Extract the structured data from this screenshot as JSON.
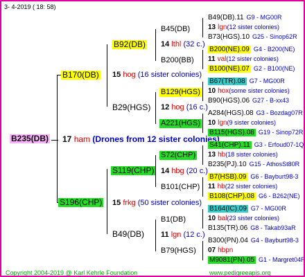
{
  "header": {
    "date": "3-  4-2019  ( 18:  58)"
  },
  "footer": {
    "copyright": "Copyright 2004-2019 @ Karl Kehrle Foundation",
    "url": "www.pedigreeapis.org"
  },
  "root": {
    "id": "B235(DB)",
    "num": "17",
    "label": "ham",
    "note": "(Drones from 12 sister colonies)"
  },
  "gen1": [
    {
      "id": "B170(DB)",
      "num": "15",
      "label": "hog",
      "note": "(16 sister colonies)"
    },
    {
      "id": "S196(CHP)",
      "num": "15",
      "label": "frkg",
      "note": "(50 sister colonies)"
    }
  ],
  "gen2": [
    {
      "id": "B92(DB)",
      "num": "14",
      "label": "lthl",
      "note": "(32 c.)"
    },
    {
      "id": "B29(HGS)",
      "num": "12",
      "label": "hog",
      "note": "(16 c.)"
    },
    {
      "id": "S119(CHP)",
      "num": "14",
      "label": "hbg",
      "note": "(20 c.)"
    },
    {
      "id": "B49(DB)",
      "num": "11",
      "label": "lgn",
      "note": "(12 c.)"
    }
  ],
  "gen3": [
    {
      "id": "B45(DB)"
    },
    {
      "id": "B200(BB)"
    },
    {
      "id": "B129(HGS)"
    },
    {
      "id": "A221(HGS)"
    },
    {
      "id": "S72(CHP)"
    },
    {
      "id": "B101(CHP)"
    },
    {
      "id": "B1(DB)"
    },
    {
      "id": "B79(HGS)"
    }
  ],
  "gen4": [
    {
      "id": "B49(DB).11",
      "ref": "G9 - MG00R"
    },
    {
      "num": "13",
      "label": "lgn",
      "note": "(12 sister colonies)"
    },
    {
      "id": "B73(HGS).10",
      "ref": "G25 - Sinop62R"
    },
    {
      "id": "B200(NE).09",
      "ref": "G4 - B200(NE)"
    },
    {
      "num": "11",
      "label": "val",
      "note": "(12 sister colonies)"
    },
    {
      "id": "B100(NE).07",
      "ref": "G2 - B100(NE)"
    },
    {
      "id": "B67(TR).08",
      "ref": "G7 - MG00R"
    },
    {
      "num": "10",
      "label": "hox",
      "note": "(some sister colonies)"
    },
    {
      "id": "B90(HGS).06",
      "ref": "G27 - B-xx43"
    },
    {
      "id": "A284(HGS).08",
      "ref": "G3 - Bozdag07R"
    },
    {
      "num": "10",
      "label": "lgn",
      "note": "(9 sister colonies)"
    },
    {
      "id": "B115(HGS).08",
      "ref": "G19 - Sinop72R"
    },
    {
      "id": "S41(CHP).11",
      "ref": "G3 - Erfoud07-1Q"
    },
    {
      "num": "13",
      "label": "hb",
      "note": "(18 sister colonies)"
    },
    {
      "id": "B235(PJ).10",
      "ref": "G15 - AthosSt80R"
    },
    {
      "id": "B7(HSB).09",
      "ref": "G6 - Bayburt98-3"
    },
    {
      "num": "11",
      "label": "hb",
      "note": "(22 sister colonies)"
    },
    {
      "id": "B108(CHP).08",
      "ref": "G6 - B262(NE)"
    },
    {
      "id": "B164(IC).09",
      "ref": "G7 - MG00R"
    },
    {
      "num": "10",
      "label": "bal",
      "note": "(23 sister colonies)"
    },
    {
      "id": "B135(TR).06",
      "ref": "G8 - Takab93aR"
    },
    {
      "id": "B300(PN).04",
      "ref": "G4 - Bayburt98-3"
    },
    {
      "num": "07",
      "label": "hbpn",
      "note": ""
    },
    {
      "id": "M9081(PN).05",
      "ref": "G1 - Margret04R"
    }
  ]
}
